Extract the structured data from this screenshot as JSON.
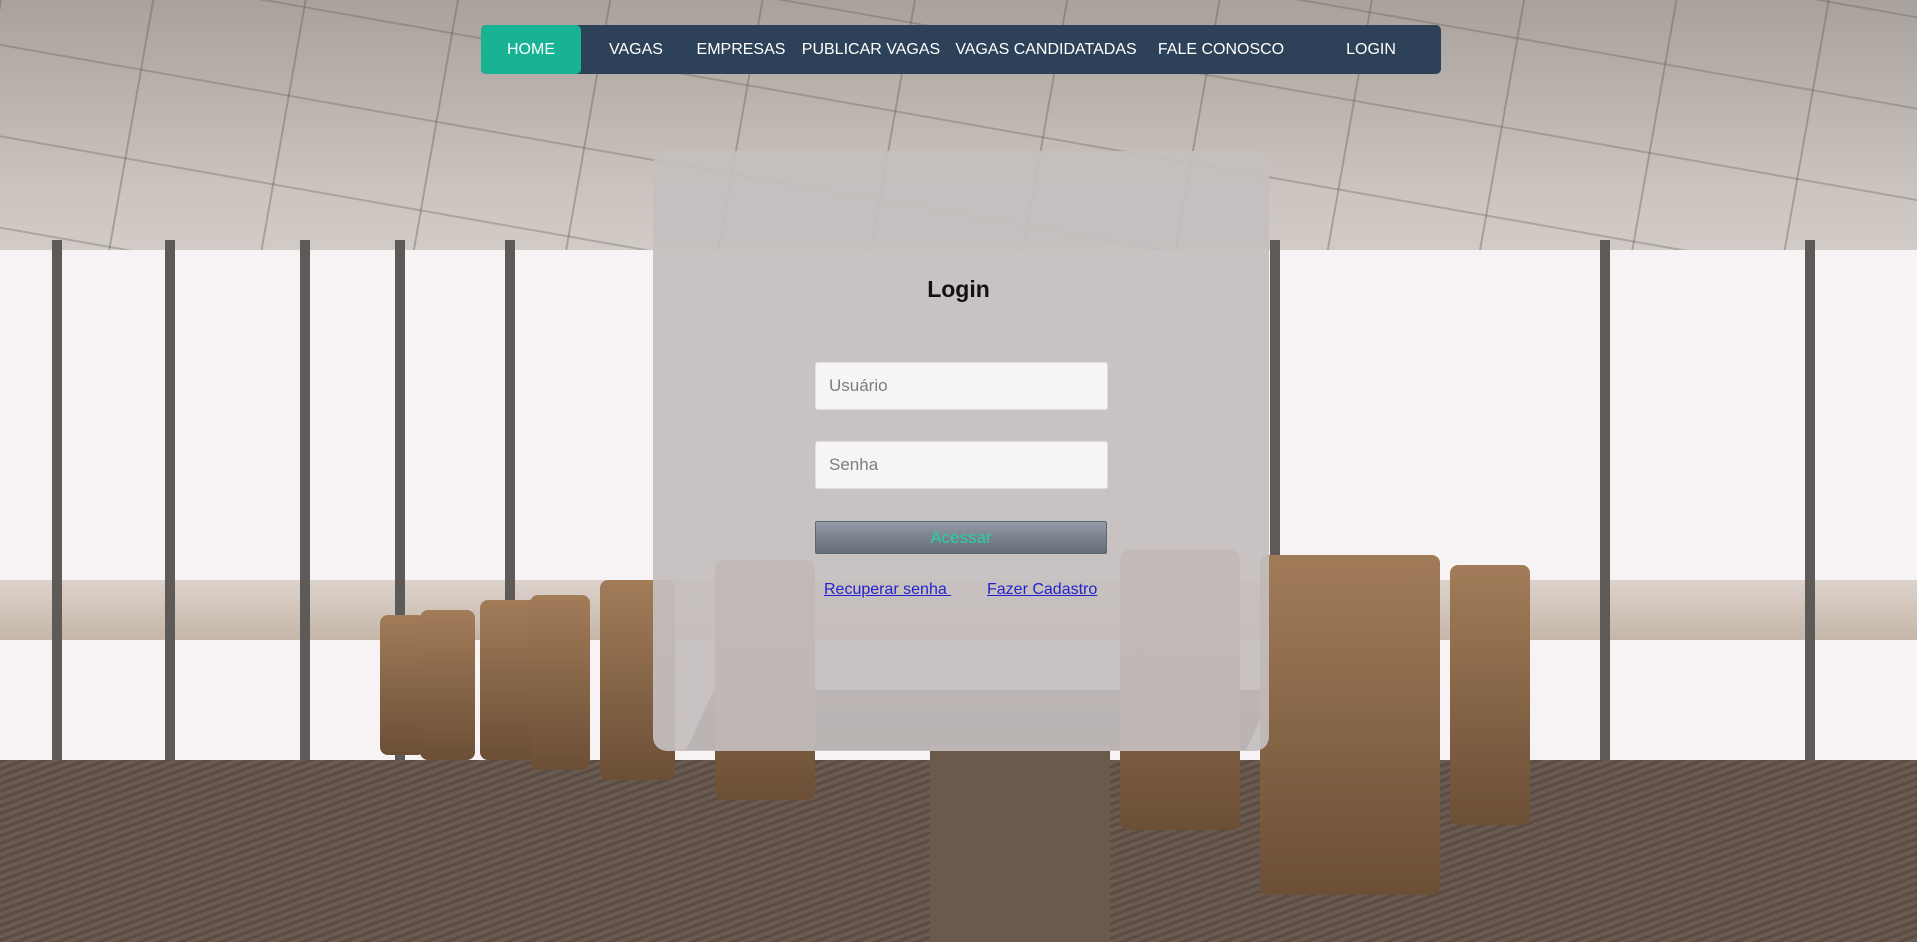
{
  "nav": {
    "items": [
      {
        "label": "HOME",
        "active": true
      },
      {
        "label": "VAGAS",
        "active": false
      },
      {
        "label": "EMPRESAS",
        "active": false
      },
      {
        "label": "PUBLICAR VAGAS",
        "active": false
      },
      {
        "label": "VAGAS CANDIDATADAS",
        "active": false
      },
      {
        "label": "FALE CONOSCO",
        "active": false
      },
      {
        "label": "LOGIN",
        "active": false
      }
    ]
  },
  "login": {
    "title": "Login",
    "username_placeholder": "Usuário",
    "username_value": "",
    "password_placeholder": "Senha",
    "password_value": "",
    "submit_label": "Acessar",
    "recover_link": "Recuperar senha ",
    "register_link": "Fazer Cadastro"
  },
  "colors": {
    "nav_bg": "#2d4258",
    "nav_active": "#18b294",
    "button_text": "#2bd0a0",
    "link": "#2222cc"
  }
}
